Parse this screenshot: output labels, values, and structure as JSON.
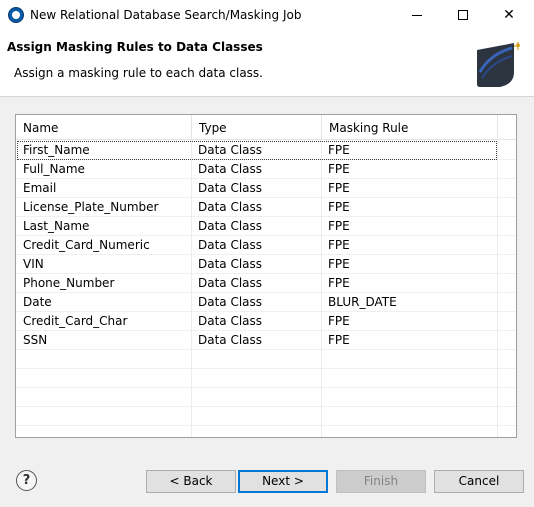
{
  "window": {
    "title": "New Relational Database Search/Masking Job",
    "minimize_glyph": "",
    "maximize_glyph": "",
    "close_glyph": "✕"
  },
  "header": {
    "title": "Assign Masking Rules to Data Classes",
    "description": "Assign a masking rule to each data class."
  },
  "table": {
    "columns": [
      "Name",
      "Type",
      "Masking Rule"
    ],
    "rows": [
      {
        "name": "First_Name",
        "type": "Data Class",
        "rule": "FPE"
      },
      {
        "name": "Full_Name",
        "type": "Data Class",
        "rule": "FPE"
      },
      {
        "name": "Email",
        "type": "Data Class",
        "rule": "FPE"
      },
      {
        "name": "License_Plate_Number",
        "type": "Data Class",
        "rule": "FPE"
      },
      {
        "name": "Last_Name",
        "type": "Data Class",
        "rule": "FPE"
      },
      {
        "name": "Credit_Card_Numeric",
        "type": "Data Class",
        "rule": "FPE"
      },
      {
        "name": "VIN",
        "type": "Data Class",
        "rule": "FPE"
      },
      {
        "name": "Phone_Number",
        "type": "Data Class",
        "rule": "FPE"
      },
      {
        "name": "Date",
        "type": "Data Class",
        "rule": "BLUR_DATE"
      },
      {
        "name": "Credit_Card_Char",
        "type": "Data Class",
        "rule": "FPE"
      },
      {
        "name": "SSN",
        "type": "Data Class",
        "rule": "FPE"
      }
    ]
  },
  "footer": {
    "help_label": "?",
    "back_label": "< Back",
    "next_label": "Next >",
    "finish_label": "Finish",
    "cancel_label": "Cancel"
  },
  "colors": {
    "accent": "#0078d7",
    "app_icon": "#0b5aa8"
  }
}
